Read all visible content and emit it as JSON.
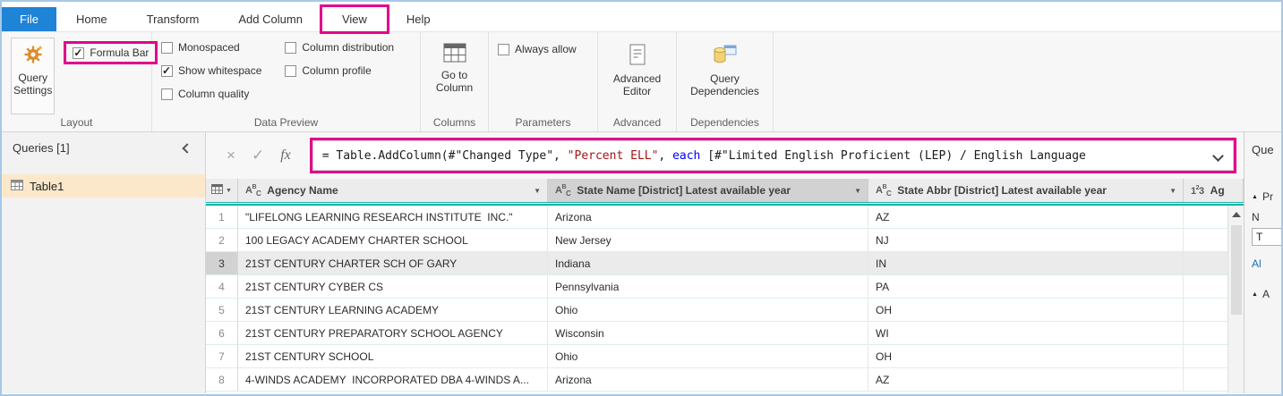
{
  "colors": {
    "accent_teal": "#10b3a2",
    "file_tab_blue": "#1f83d6",
    "annotation_magenta": "#e3008c",
    "selected_query_bg": "#fbe8cb",
    "string_token": "#a31515",
    "keyword_token": "#0000ff"
  },
  "icons": {
    "cancel_formula": "×",
    "commit_formula": "✓",
    "filter_dropdown": "▼",
    "section_collapse": "▲",
    "collapse_pane": "css-chevron-left",
    "expand_formula": "css-chevron-down",
    "scroll_up": "css-triangle-up"
  },
  "ribbon_tabs": [
    {
      "label": "File",
      "style": "file"
    },
    {
      "label": "Home"
    },
    {
      "label": "Transform"
    },
    {
      "label": "Add Column"
    },
    {
      "label": "View",
      "annotated": true
    },
    {
      "label": "Help"
    }
  ],
  "ribbon": {
    "groups": {
      "layout": {
        "label": "Layout",
        "query_settings_button": "Query Settings",
        "formula_bar_checkbox": {
          "label": "Formula Bar",
          "checked": true,
          "annotated": true
        }
      },
      "data_preview": {
        "label": "Data Preview",
        "checkboxes": [
          {
            "label": "Monospaced",
            "checked": false
          },
          {
            "label": "Show whitespace",
            "checked": true
          },
          {
            "label": "Column quality",
            "checked": false
          },
          {
            "label": "Column distribution",
            "checked": false
          },
          {
            "label": "Column profile",
            "checked": false
          }
        ]
      },
      "columns": {
        "label": "Columns",
        "go_to_column_button": "Go to Column"
      },
      "parameters": {
        "label": "Parameters",
        "always_allow_checkbox": {
          "label": "Always allow",
          "checked": false
        }
      },
      "advanced": {
        "label": "Advanced",
        "advanced_editor_button": "Advanced Editor"
      },
      "dependencies": {
        "label": "Dependencies",
        "query_dependencies_button": "Query Dependencies"
      }
    }
  },
  "queries_pane": {
    "title": "Queries [1]",
    "items": [
      {
        "label": "Table1",
        "selected": true
      }
    ]
  },
  "formula_bar": {
    "fx_label": "fx",
    "tokens": [
      {
        "text": "= Table.AddColumn(#\"Changed Type\", ",
        "type": "plain"
      },
      {
        "text": "\"Percent ELL\"",
        "type": "string"
      },
      {
        "text": ", ",
        "type": "plain"
      },
      {
        "text": "each",
        "type": "keyword"
      },
      {
        "text": " [#\"Limited English Proficient (LEP) / English Language",
        "type": "plain"
      }
    ]
  },
  "table": {
    "columns": [
      {
        "type_icon": "ABC",
        "label": "Agency Name",
        "selected": false
      },
      {
        "type_icon": "ABC",
        "label": "State Name [District] Latest available year",
        "selected": true
      },
      {
        "type_icon": "ABC",
        "label": "State Abbr [District] Latest available year",
        "selected": false
      },
      {
        "type_icon": "123",
        "label": "Ag",
        "selected": false
      }
    ],
    "rows": [
      {
        "num": "1",
        "cells": [
          "\"LIFELONG LEARNING RESEARCH INSTITUTE  INC.\"",
          "Arizona",
          "AZ",
          ""
        ]
      },
      {
        "num": "2",
        "cells": [
          "100 LEGACY ACADEMY CHARTER SCHOOL",
          "New Jersey",
          "NJ",
          ""
        ]
      },
      {
        "num": "3",
        "cells": [
          "21ST CENTURY CHARTER SCH OF GARY",
          "Indiana",
          "IN",
          ""
        ],
        "selected": true
      },
      {
        "num": "4",
        "cells": [
          "21ST CENTURY CYBER CS",
          "Pennsylvania",
          "PA",
          ""
        ]
      },
      {
        "num": "5",
        "cells": [
          "21ST CENTURY LEARNING ACADEMY",
          "Ohio",
          "OH",
          ""
        ]
      },
      {
        "num": "6",
        "cells": [
          "21ST CENTURY PREPARATORY SCHOOL AGENCY",
          "Wisconsin",
          "WI",
          ""
        ]
      },
      {
        "num": "7",
        "cells": [
          "21ST CENTURY SCHOOL",
          "Ohio",
          "OH",
          ""
        ]
      },
      {
        "num": "8",
        "cells": [
          "4-WINDS ACADEMY  INCORPORATED DBA 4-WINDS A...",
          "Arizona",
          "AZ",
          ""
        ]
      }
    ]
  },
  "settings_pane": {
    "title_truncated": "Que",
    "properties_truncated": "Pr",
    "name_label_truncated": "N",
    "name_value_truncated": "T",
    "all_properties_truncated": "Al",
    "applied_steps_truncated": "A"
  }
}
